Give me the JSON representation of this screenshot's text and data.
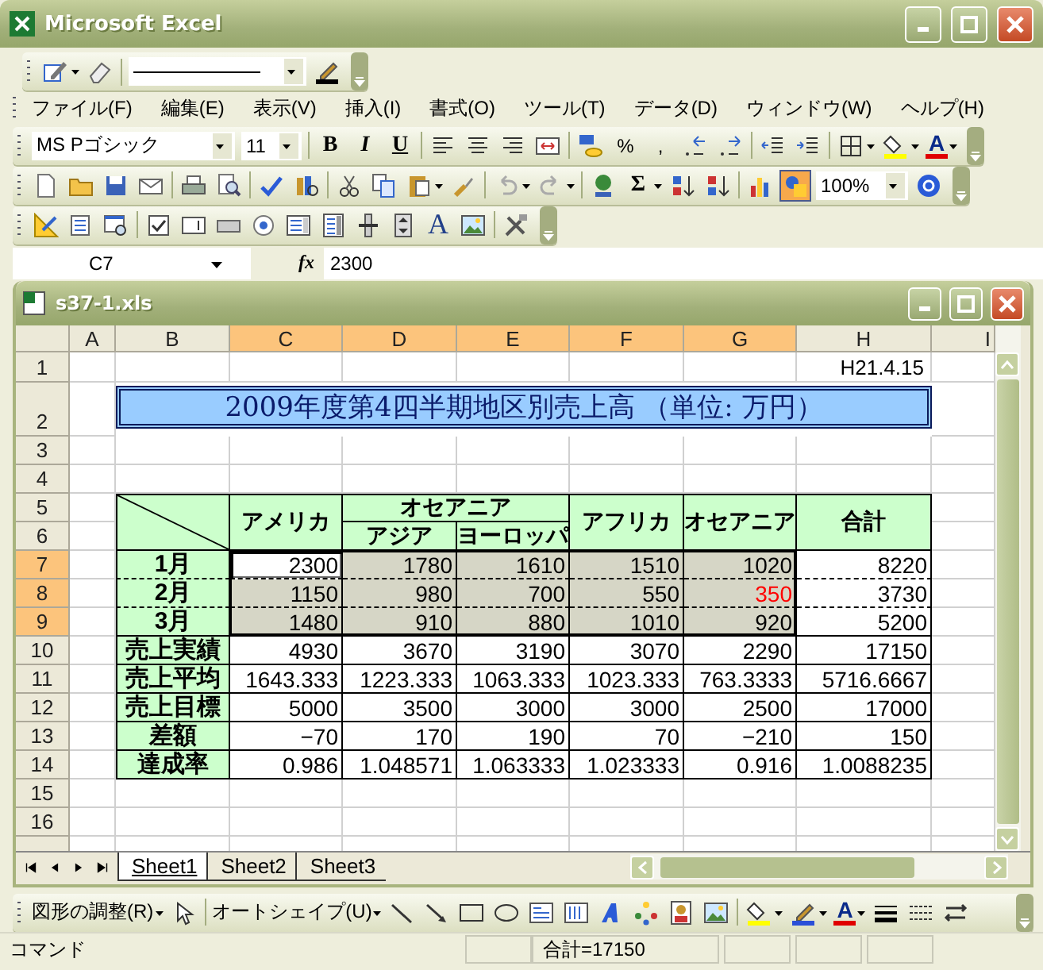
{
  "app": {
    "title": "Microsoft Excel"
  },
  "menu": [
    {
      "label": "ファイル(F)"
    },
    {
      "label": "編集(E)"
    },
    {
      "label": "表示(V)"
    },
    {
      "label": "挿入(I)"
    },
    {
      "label": "書式(O)"
    },
    {
      "label": "ツール(T)"
    },
    {
      "label": "データ(D)"
    },
    {
      "label": "ウィンドウ(W)"
    },
    {
      "label": "ヘルプ(H)"
    }
  ],
  "formatting_toolbar": {
    "font": "MS Pゴシック",
    "size": "11",
    "glyphs": [
      "B",
      "I",
      "U",
      "%",
      ",",
      "A"
    ]
  },
  "standard_toolbar": {
    "glyphs": [
      "Σ"
    ],
    "drawing_on": true,
    "zoom": "100%"
  },
  "forms_toolbar": {
    "glyphs": [
      "A"
    ]
  },
  "formula_bar": {
    "name_box": "C7",
    "function_label": "fx",
    "formula": "2300"
  },
  "workbook": {
    "title": "s37-1.xls",
    "columns": [
      {
        "label": "A",
        "selected": false
      },
      {
        "label": "B",
        "selected": false
      },
      {
        "label": "C",
        "selected": true
      },
      {
        "label": "D",
        "selected": true
      },
      {
        "label": "E",
        "selected": true
      },
      {
        "label": "F",
        "selected": true
      },
      {
        "label": "G",
        "selected": true
      },
      {
        "label": "H",
        "selected": false
      },
      {
        "label": "I",
        "selected": false
      }
    ],
    "rows": [
      {
        "label": "1",
        "selected": false
      },
      {
        "label": "2",
        "selected": false
      },
      {
        "label": "3",
        "selected": false
      },
      {
        "label": "4",
        "selected": false
      },
      {
        "label": "5",
        "selected": false
      },
      {
        "label": "6",
        "selected": false
      },
      {
        "label": "7",
        "selected": true
      },
      {
        "label": "8",
        "selected": true
      },
      {
        "label": "9",
        "selected": true
      },
      {
        "label": "10",
        "selected": false
      },
      {
        "label": "11",
        "selected": false
      },
      {
        "label": "12",
        "selected": false
      },
      {
        "label": "13",
        "selected": false
      },
      {
        "label": "14",
        "selected": false
      },
      {
        "label": "15",
        "selected": false
      },
      {
        "label": "16",
        "selected": false
      }
    ],
    "date": "H21.4.15",
    "title_cell": "2009年度第4四半期地区別売上高 （単位: 万円）",
    "table": {
      "headers": [
        {
          "label": "アメリカ"
        },
        {
          "label": "オセアニア",
          "children": [
            {
              "label": "アジア"
            },
            {
              "label": "ヨーロッパ"
            }
          ]
        },
        {
          "label": "アフリカ"
        },
        {
          "label": "オセアニア"
        },
        {
          "label": "合計"
        }
      ],
      "rows": [
        {
          "label": "1月",
          "kind": "month",
          "cells": [
            {
              "value": "2300",
              "selected": true,
              "active": true
            },
            {
              "value": "1780",
              "selected": true,
              "active": false
            },
            {
              "value": "1610",
              "selected": true,
              "active": false
            },
            {
              "value": "1510",
              "selected": true,
              "active": false
            },
            {
              "value": "1020",
              "selected": true,
              "active": false
            },
            {
              "value": "8220",
              "selected": false,
              "active": false
            }
          ]
        },
        {
          "label": "2月",
          "kind": "month",
          "cells": [
            {
              "value": "1150",
              "selected": true,
              "active": false
            },
            {
              "value": "980",
              "selected": true,
              "active": false
            },
            {
              "value": "700",
              "selected": true,
              "active": false
            },
            {
              "value": "550",
              "selected": true,
              "active": false
            },
            {
              "value": "350",
              "selected": true,
              "active": false,
              "color": "#ff0000"
            },
            {
              "value": "3730",
              "selected": false,
              "active": false
            }
          ]
        },
        {
          "label": "3月",
          "kind": "month",
          "cells": [
            {
              "value": "1480",
              "selected": true,
              "active": false
            },
            {
              "value": "910",
              "selected": true,
              "active": false
            },
            {
              "value": "880",
              "selected": true,
              "active": false
            },
            {
              "value": "1010",
              "selected": true,
              "active": false
            },
            {
              "value": "920",
              "selected": true,
              "active": false
            },
            {
              "value": "5200",
              "selected": false,
              "active": false
            }
          ]
        },
        {
          "label": "売上実績",
          "kind": "summary",
          "cells": [
            {
              "value": "4930",
              "selected": false,
              "active": false
            },
            {
              "value": "3670",
              "selected": false,
              "active": false
            },
            {
              "value": "3190",
              "selected": false,
              "active": false
            },
            {
              "value": "3070",
              "selected": false,
              "active": false
            },
            {
              "value": "2290",
              "selected": false,
              "active": false
            },
            {
              "value": "17150",
              "selected": false,
              "active": false
            }
          ]
        },
        {
          "label": "売上平均",
          "kind": "summary",
          "cells": [
            {
              "value": "1643.333",
              "selected": false,
              "active": false
            },
            {
              "value": "1223.333",
              "selected": false,
              "active": false
            },
            {
              "value": "1063.333",
              "selected": false,
              "active": false
            },
            {
              "value": "1023.333",
              "selected": false,
              "active": false
            },
            {
              "value": "763.3333",
              "selected": false,
              "active": false
            },
            {
              "value": "5716.6667",
              "selected": false,
              "active": false
            }
          ]
        },
        {
          "label": "売上目標",
          "kind": "summary",
          "cells": [
            {
              "value": "5000",
              "selected": false,
              "active": false
            },
            {
              "value": "3500",
              "selected": false,
              "active": false
            },
            {
              "value": "3000",
              "selected": false,
              "active": false
            },
            {
              "value": "3000",
              "selected": false,
              "active": false
            },
            {
              "value": "2500",
              "selected": false,
              "active": false
            },
            {
              "value": "17000",
              "selected": false,
              "active": false
            }
          ]
        },
        {
          "label": "差額",
          "kind": "summary",
          "cells": [
            {
              "value": "−70",
              "selected": false,
              "active": false
            },
            {
              "value": "170",
              "selected": false,
              "active": false
            },
            {
              "value": "190",
              "selected": false,
              "active": false
            },
            {
              "value": "70",
              "selected": false,
              "active": false
            },
            {
              "value": "−210",
              "selected": false,
              "active": false
            },
            {
              "value": "150",
              "selected": false,
              "active": false
            }
          ]
        },
        {
          "label": "達成率",
          "kind": "summary",
          "cells": [
            {
              "value": "0.986",
              "selected": false,
              "active": false
            },
            {
              "value": "1.048571",
              "selected": false,
              "active": false
            },
            {
              "value": "1.063333",
              "selected": false,
              "active": false
            },
            {
              "value": "1.023333",
              "selected": false,
              "active": false
            },
            {
              "value": "0.916",
              "selected": false,
              "active": false
            },
            {
              "value": "1.0088235",
              "selected": false,
              "active": false
            }
          ]
        }
      ]
    },
    "sheets": [
      {
        "label": "Sheet1",
        "selected": true
      },
      {
        "label": "Sheet2",
        "selected": false
      },
      {
        "label": "Sheet3",
        "selected": false
      }
    ]
  },
  "drawing_toolbar": {
    "draw_menu": "図形の調整(R)",
    "autoshapes_menu": "オートシェイプ(U)",
    "glyphs": [
      "A"
    ]
  },
  "status_bar": {
    "mode": "コマンド",
    "sum": "合計=17150"
  }
}
